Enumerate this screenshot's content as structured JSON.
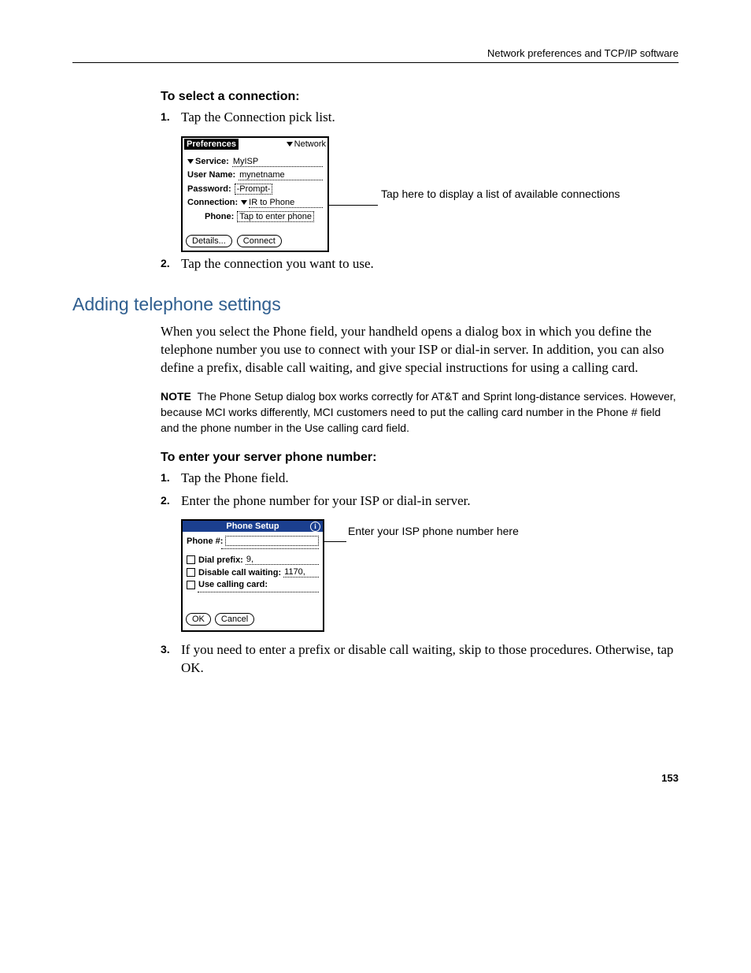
{
  "header": {
    "running": "Network preferences and TCP/IP software"
  },
  "proc1": {
    "title": "To select a connection:",
    "steps": [
      "Tap the Connection pick list.",
      "Tap the connection you want to use."
    ]
  },
  "fig1": {
    "title": "Preferences",
    "menu": "Network",
    "service_label": "Service:",
    "service_value": "MyISP",
    "username_label": "User Name:",
    "username_value": "mynetname",
    "password_label": "Password:",
    "password_value": "-Prompt-",
    "connection_label": "Connection:",
    "connection_value": "IR to Phone",
    "phone_label": "Phone:",
    "phone_value": "Tap to enter phone",
    "btn_details": "Details...",
    "btn_connect": "Connect",
    "callout": "Tap here to display a list of available connections"
  },
  "section": {
    "heading": "Adding telephone settings",
    "para": "When you select the Phone field, your handheld opens a dialog box in which you define the telephone number you use to connect with your ISP or dial-in server. In addition, you can also define a prefix, disable call waiting, and give special instructions for using a calling card."
  },
  "note": {
    "label": "NOTE",
    "text": "The Phone Setup dialog box works correctly for AT&T and Sprint long-distance services. However, because MCI works differently, MCI customers need to put the calling card number in the Phone # field and the phone number in the Use calling card field."
  },
  "proc2": {
    "title": "To enter your server phone number:",
    "steps": [
      "Tap the Phone field.",
      "Enter the phone number for your ISP or dial-in server.",
      "If you need to enter a prefix or disable call waiting, skip to those procedures. Otherwise, tap OK."
    ]
  },
  "fig2": {
    "title": "Phone Setup",
    "phone_label": "Phone #:",
    "dial_prefix_label": "Dial prefix:",
    "dial_prefix_value": "9,",
    "disable_cw_label": "Disable call waiting:",
    "disable_cw_value": "1170,",
    "calling_card_label": "Use calling card:",
    "btn_ok": "OK",
    "btn_cancel": "Cancel",
    "callout": "Enter your ISP phone number here"
  },
  "page_number": "153"
}
